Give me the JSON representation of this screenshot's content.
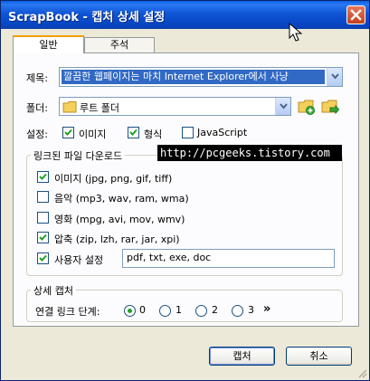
{
  "window": {
    "title": "ScrapBook - 캡처 상세 설정"
  },
  "tabs": [
    {
      "label": "일반"
    },
    {
      "label": "주석"
    }
  ],
  "subject": {
    "label": "제목:",
    "value": "깔끔한 웹페이지는 마치 Internet Explorer에서 사냥"
  },
  "folder": {
    "label": "폴더:",
    "value": "루트 폴더"
  },
  "settings": {
    "label": "설정:",
    "options": [
      {
        "label": "이미지",
        "checked": true
      },
      {
        "label": "형식",
        "checked": true
      },
      {
        "label": "JavaScript",
        "checked": false
      }
    ]
  },
  "linked_files": {
    "title": "링크된 파일 다운로드",
    "items": [
      {
        "label": "이미지 (jpg, png, gif, tiff)",
        "checked": true
      },
      {
        "label": "음악 (mp3, wav, ram, wma)",
        "checked": false
      },
      {
        "label": "영화 (mpg, avi, mov, wmv)",
        "checked": false
      },
      {
        "label": "압축 (zip, lzh, rar, jar, xpi)",
        "checked": true
      },
      {
        "label": "사용자 설정",
        "checked": true
      }
    ],
    "custom_value": "pdf, txt, exe, doc"
  },
  "watermark": "http://pcgeeks.tistory.com",
  "detail_capture": {
    "title": "상세 캡처",
    "label": "연결 링크 단계:",
    "options": [
      "0",
      "1",
      "2",
      "3"
    ],
    "selected": "0",
    "more": "»"
  },
  "buttons": {
    "capture": "캡처",
    "cancel": "취소"
  },
  "colors": {
    "title_bar": "#0a5fe0",
    "selection": "#316ac5",
    "check": "#21a121",
    "tab_highlight": "#f0a000"
  }
}
